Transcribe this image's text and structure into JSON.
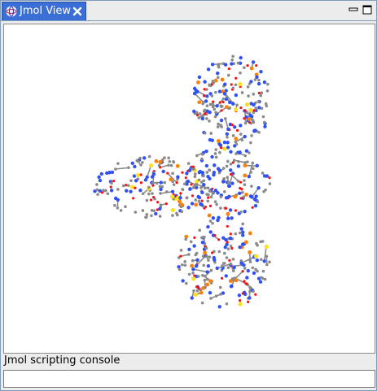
{
  "view": {
    "tab_title": "Jmol View",
    "tab_icon": "jmol-globe-icon",
    "close_icon": "close-icon",
    "minimize_icon": "minimize-icon",
    "maximize_icon": "maximize-icon"
  },
  "console": {
    "label": "Jmol scripting console",
    "input_value": ""
  },
  "colors": {
    "tab_active": "#3b6fd8",
    "carbon": "#8a8a8a",
    "nitrogen": "#3050f8",
    "oxygen": "#ff0d0d",
    "phosphorus": "#ff8000",
    "sulfur": "#ffe020"
  }
}
